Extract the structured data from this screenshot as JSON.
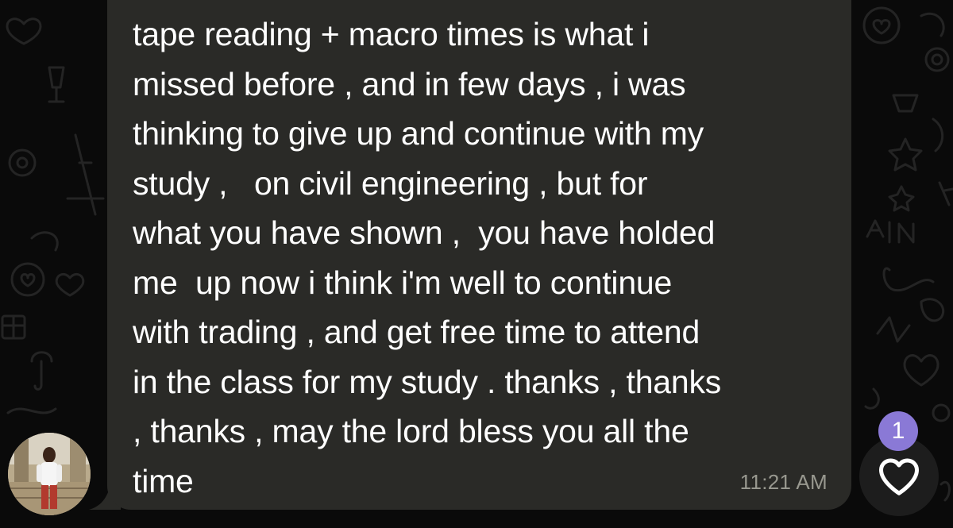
{
  "message": {
    "text": "tape reading + macro times is what i\nmissed before , and in few days , i was\nthinking to give up and continue with my\nstudy ,   on civil engineering , but for\nwhat you have shown ,  you have holded\nme  up now i think i'm well to continue\nwith trading , and get free time to attend\nin the class for my study . thanks , thanks\n, thanks , may the lord bless you all the\ntime",
    "time": "11:21 AM"
  },
  "reaction": {
    "icon": "heart-outline-icon",
    "count": "1",
    "badge_color": "#8a79d6"
  },
  "colors": {
    "background": "#0a0a0a",
    "bubble": "#2a2a27",
    "text": "#ffffff",
    "timestamp": "#98988f"
  }
}
